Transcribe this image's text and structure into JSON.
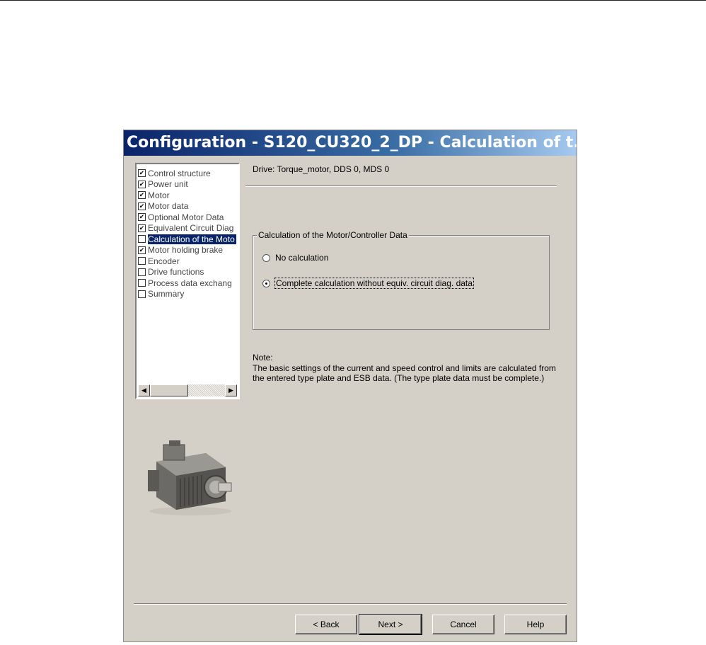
{
  "window": {
    "title": "Configuration - S120_CU320_2_DP - Calculation of t..."
  },
  "navigation": {
    "items": [
      {
        "label": "Control structure",
        "checked": true,
        "selected": false
      },
      {
        "label": "Power unit",
        "checked": true,
        "selected": false
      },
      {
        "label": "Motor",
        "checked": true,
        "selected": false
      },
      {
        "label": "Motor data",
        "checked": true,
        "selected": false
      },
      {
        "label": "Optional Motor Data",
        "checked": true,
        "selected": false
      },
      {
        "label": "Equivalent Circuit Diag",
        "checked": true,
        "selected": false
      },
      {
        "label": "Calculation of the Moto",
        "checked": false,
        "selected": true
      },
      {
        "label": "Motor holding brake",
        "checked": true,
        "selected": false
      },
      {
        "label": "Encoder",
        "checked": false,
        "selected": false
      },
      {
        "label": "Drive functions",
        "checked": false,
        "selected": false
      },
      {
        "label": "Process data exchang",
        "checked": false,
        "selected": false
      },
      {
        "label": "Summary",
        "checked": false,
        "selected": false
      }
    ]
  },
  "main": {
    "drive_info": "Drive: Torque_motor, DDS 0, MDS 0",
    "group_title": "Calculation of the Motor/Controller Data",
    "options": [
      {
        "label": "No calculation",
        "checked": false
      },
      {
        "label": "Complete calculation without equiv. circuit diag. data",
        "checked": true
      }
    ],
    "note_title": "Note:",
    "note_text": "The basic settings of the current and speed control and limits are calculated from the entered type plate and ESB data. (The type plate data must be complete.)"
  },
  "buttons": {
    "back": "< Back",
    "next": "Next >",
    "cancel": "Cancel",
    "help": "Help"
  }
}
